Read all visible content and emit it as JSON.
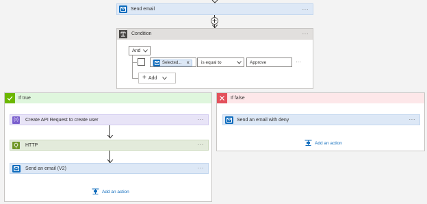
{
  "top_step": {
    "title": "Send email",
    "more": "···"
  },
  "condition": {
    "title": "Condition",
    "more": "···",
    "operator": "And",
    "row": {
      "token": "Selected...",
      "token_remove": "×",
      "comparator": "is equal to",
      "value": "Approve",
      "more": "···"
    },
    "add_label": "Add"
  },
  "if_true": {
    "title": "If true",
    "steps": [
      {
        "label": "Create API Request to create user",
        "more": "···"
      },
      {
        "label": "HTTP",
        "more": "···"
      },
      {
        "label": "Send an email (V2)",
        "more": "···"
      }
    ],
    "add_action": "Add an action"
  },
  "if_false": {
    "title": "If false",
    "steps": [
      {
        "label": "Send an email with deny",
        "more": "···"
      }
    ],
    "add_action": "Add an action"
  },
  "colors": {
    "outlook": "#0f6cbd",
    "condition_header": "#e1dfdd",
    "true_header": "#dff6dd",
    "true_accent": "#6bb700",
    "false_header": "#fde7e9",
    "false_accent": "#e3505b",
    "api_card": "#e8e4f7",
    "api_icon": "#7a5fce",
    "http_card": "#e3ebdb",
    "http_icon": "#709727",
    "email_card": "#dde8f6"
  }
}
